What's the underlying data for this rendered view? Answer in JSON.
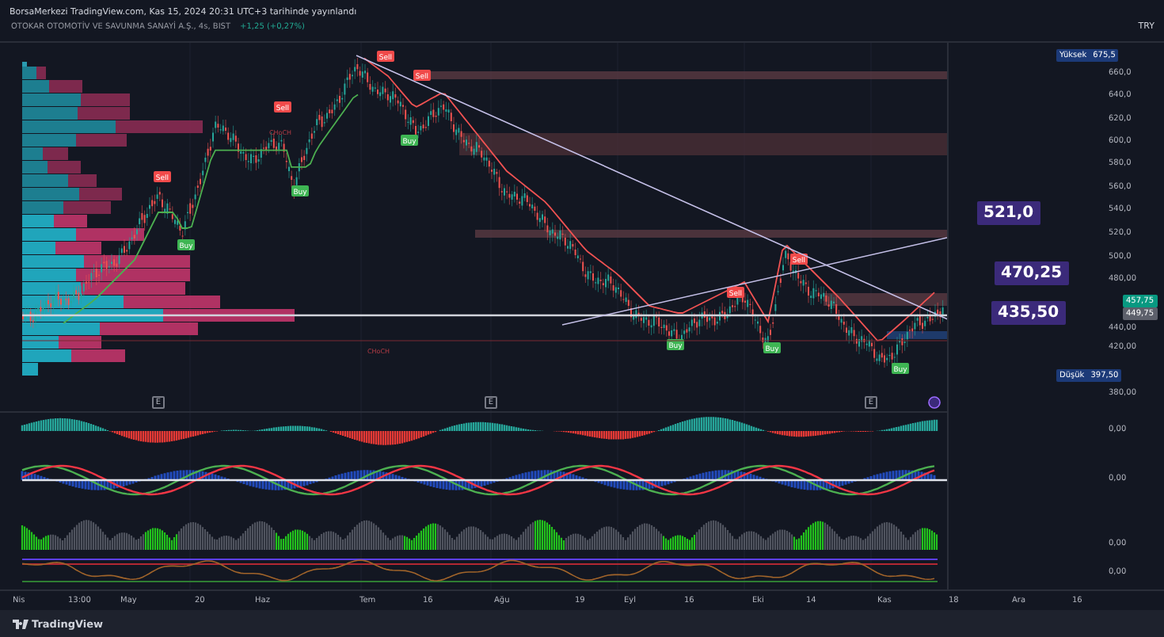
{
  "header": {
    "published": "BorsaMerkezi TradingView.com, Kas 15, 2024 20:31 UTC+3 tarihinde yayınlandı",
    "currency": "TRY"
  },
  "symbol": {
    "name": "OTOKAR OTOMOTİV VE SAVUNMA SANAYİ A.Ş., 4s, BIST",
    "change": "+1,25 (+0,27%)"
  },
  "price_axis": {
    "labels": [
      "660,0",
      "640,0",
      "620,0",
      "600,0",
      "580,0",
      "560,0",
      "540,0",
      "520,0",
      "500,0",
      "480,00",
      "440,00",
      "420,00",
      "380,00"
    ],
    "high": {
      "label": "Yüksek",
      "value": "675,5"
    },
    "low": {
      "label": "Düşük",
      "value": "397,50"
    },
    "last_price": "457,75",
    "prev_close": "449,75"
  },
  "callouts": [
    "521,0",
    "470,25",
    "435,50"
  ],
  "signals": [
    {
      "kind": "sell",
      "label": "Sell"
    },
    {
      "kind": "buy",
      "label": "Buy"
    },
    {
      "kind": "sell",
      "label": "Sell"
    },
    {
      "kind": "buy",
      "label": "Buy"
    },
    {
      "kind": "sell",
      "label": "Sell"
    },
    {
      "kind": "sell",
      "label": "Sell"
    },
    {
      "kind": "buy",
      "label": "Buy"
    },
    {
      "kind": "buy",
      "label": "Buy"
    },
    {
      "kind": "sell",
      "label": "Sell"
    },
    {
      "kind": "buy",
      "label": "Buy"
    },
    {
      "kind": "sell",
      "label": "Sell"
    },
    {
      "kind": "buy",
      "label": "Buy"
    }
  ],
  "structure_labels": [
    "CHoCH",
    "CHoCH"
  ],
  "events": [
    {
      "kind": "earnings",
      "label": "E"
    },
    {
      "kind": "earnings",
      "label": "E"
    },
    {
      "kind": "earnings",
      "label": "E"
    },
    {
      "kind": "dividend"
    }
  ],
  "indicator_axis": [
    "0,00",
    "0,00",
    "0,00",
    "0,00"
  ],
  "time_axis": [
    "Nis",
    "13:00",
    "May",
    "20",
    "Haz",
    "Tem",
    "16",
    "Ağu",
    "19",
    "Eyl",
    "16",
    "Eki",
    "14",
    "Kas",
    "18",
    "Ara",
    "16"
  ],
  "footer": {
    "logo": "TradingView"
  }
}
